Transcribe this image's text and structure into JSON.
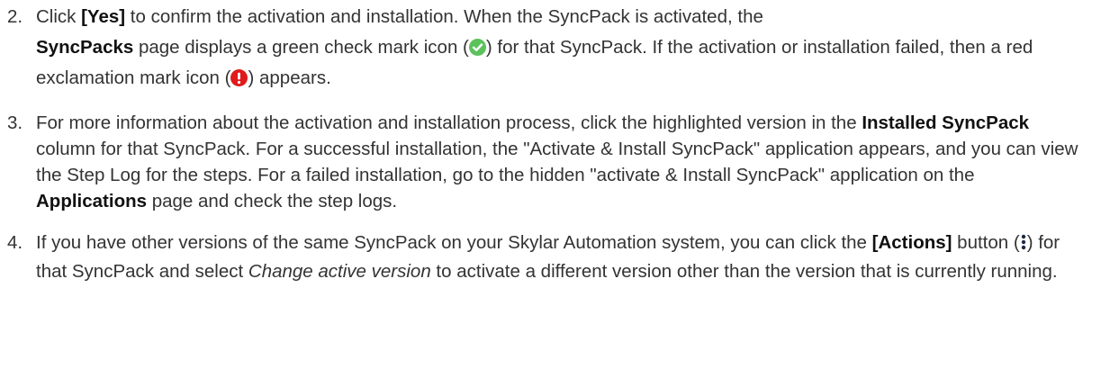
{
  "steps": [
    {
      "number": "2.",
      "t1": "Click ",
      "b1": "[Yes]",
      "t2": " to confirm the activation and installation. When the SyncPack is activated, the",
      "b2": "SyncPacks",
      "t3": " page displays a green check mark icon (",
      "icon1": "green-check-circle-icon",
      "t4": ") for that SyncPack. If the activation or installation failed, then a red exclamation mark icon (",
      "icon2": "red-exclamation-circle-icon",
      "t5": ") appears."
    },
    {
      "number": "3.",
      "t1": "For more information about the activation and installation process, click the highlighted version in the ",
      "b1": "Installed SyncPack",
      "t2": " column for that SyncPack. For a successful installation, the \"Activate & Install SyncPack\" application appears, and you can view the Step Log for the steps. For a failed installation, go to the hidden \"activate & Install SyncPack\" application on the ",
      "b2": "Applications",
      "t3": " page and check the step logs."
    },
    {
      "number": "4.",
      "t1": "If you have other versions of the same SyncPack on your Skylar Automation system, you can click the ",
      "b1": "[Actions]",
      "t2": " button (",
      "icon1": "vertical-ellipsis-icon",
      "t3": ") for that SyncPack and select ",
      "i1": "Change active version",
      "t4": " to activate a different version other than the version that is currently running."
    }
  ],
  "colors": {
    "text": "#333333",
    "check_green": "#5cc25c",
    "exclamation_red": "#e01b1b"
  }
}
